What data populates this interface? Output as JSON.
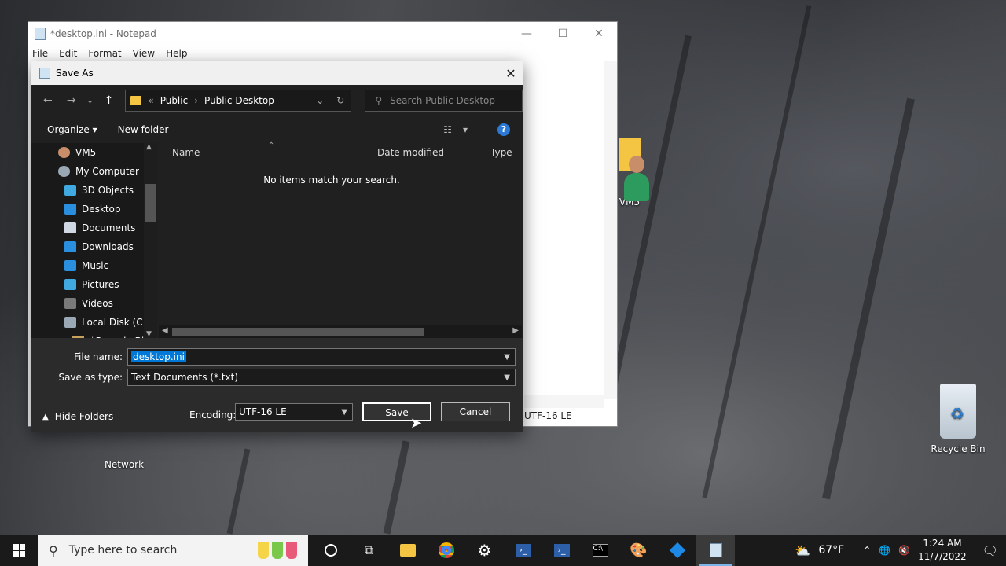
{
  "desktop": {
    "icons": {
      "network": "Network",
      "recycle_bin": "Recycle Bin",
      "vm5": "VM5"
    }
  },
  "notepad": {
    "title": "*desktop.ini - Notepad",
    "menu": [
      "File",
      "Edit",
      "Format",
      "View",
      "Help"
    ],
    "status_encoding": "UTF-16 LE"
  },
  "dialog": {
    "title": "Save As",
    "breadcrumb": [
      "Public",
      "Public Desktop"
    ],
    "search_placeholder": "Search Public Desktop",
    "organize_label": "Organize",
    "new_folder_label": "New folder",
    "tree": [
      {
        "label": "VM5",
        "icon": "user-icon",
        "indent": 1
      },
      {
        "label": "My Computer",
        "icon": "computer-icon",
        "indent": 1
      },
      {
        "label": "3D Objects",
        "icon": "cube-icon",
        "indent": 2
      },
      {
        "label": "Desktop",
        "icon": "desktop-icon",
        "indent": 2
      },
      {
        "label": "Documents",
        "icon": "document-icon",
        "indent": 2
      },
      {
        "label": "Downloads",
        "icon": "download-icon",
        "indent": 2
      },
      {
        "label": "Music",
        "icon": "music-icon",
        "indent": 2
      },
      {
        "label": "Pictures",
        "icon": "picture-icon",
        "indent": 2
      },
      {
        "label": "Videos",
        "icon": "video-icon",
        "indent": 2
      },
      {
        "label": "Local Disk (C:)",
        "icon": "drive-icon",
        "indent": 2
      },
      {
        "label": "$Recycle.Bin",
        "icon": "folder-icon",
        "indent": 3
      }
    ],
    "columns": [
      "Name",
      "Date modified",
      "Type"
    ],
    "empty_message": "No items match your search.",
    "file_name_label": "File name:",
    "file_name_value": "desktop.ini",
    "save_type_label": "Save as type:",
    "save_type_value": "Text Documents (*.txt)",
    "hide_folders_label": "Hide Folders",
    "encoding_label": "Encoding:",
    "encoding_value": "UTF-16 LE",
    "save_label": "Save",
    "cancel_label": "Cancel"
  },
  "taskbar": {
    "search_placeholder": "Type here to search",
    "weather": "67°F",
    "time": "1:24 AM",
    "date": "11/7/2022"
  },
  "colors": {
    "accent": "#0078d7",
    "dialog_bg": "#202020",
    "taskbar_bg": "#1a1a1a"
  }
}
